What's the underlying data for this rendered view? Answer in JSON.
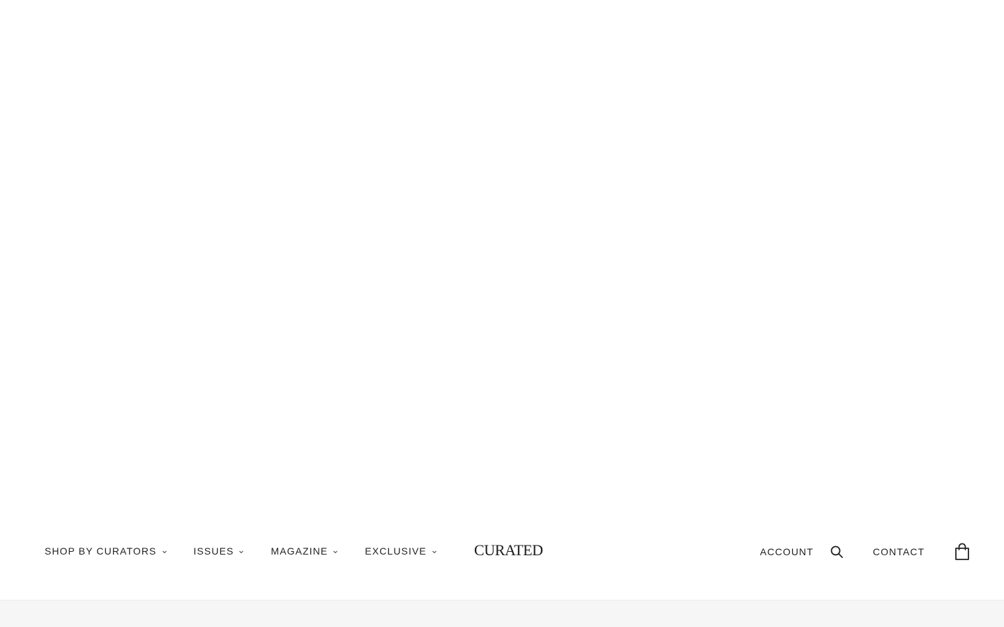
{
  "brand": {
    "logo_text": "CURATED"
  },
  "nav": {
    "items": [
      {
        "label": "SHOP BY CURATORS",
        "icon": "chevron-down-icon"
      },
      {
        "label": "ISSUES",
        "icon": "chevron-down-icon"
      },
      {
        "label": "MAGAZINE",
        "icon": "chevron-down-icon"
      },
      {
        "label": "EXCLUSIVE",
        "icon": "chevron-down-icon"
      }
    ]
  },
  "header_right": {
    "account_label": "ACCOUNT",
    "search_icon": "search-icon",
    "contact_label": "CONTACT",
    "cart_icon": "shopping-bag-icon"
  },
  "colors": {
    "text": "#222222",
    "background": "#ffffff",
    "footer_strip": "#f6f6f6"
  }
}
